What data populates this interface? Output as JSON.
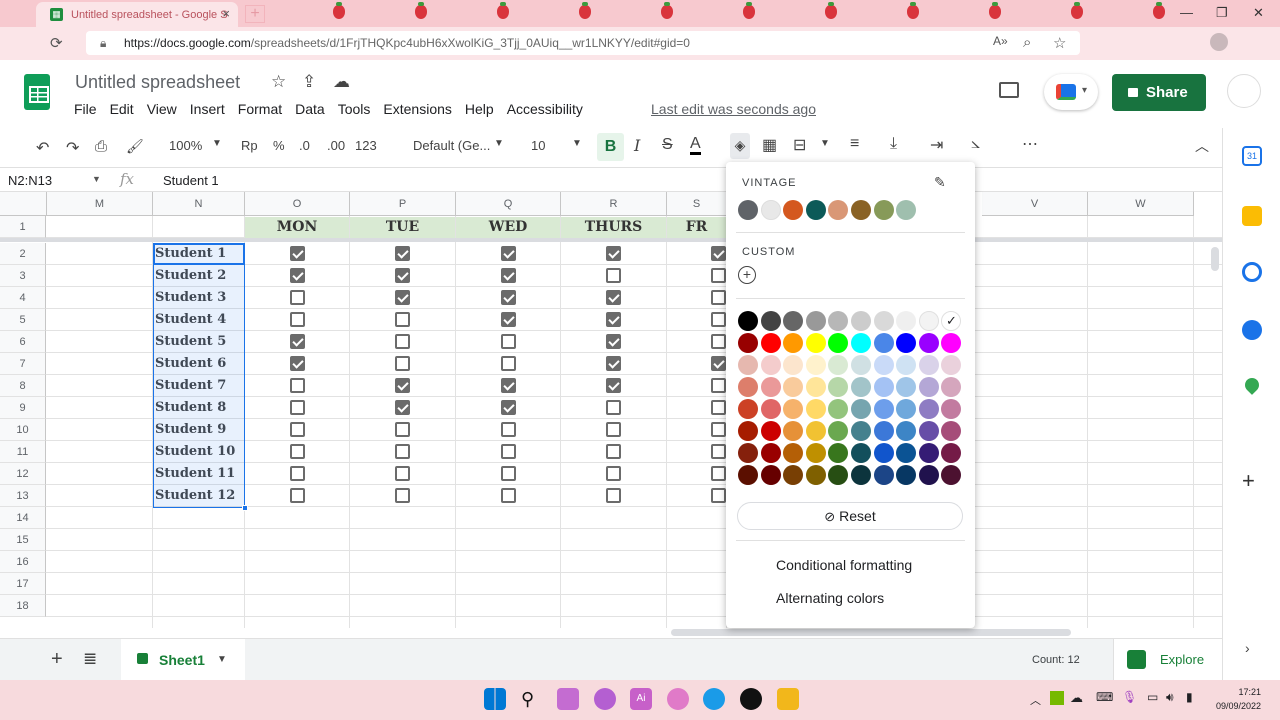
{
  "browser": {
    "tab_title": "Untitled spreadsheet - Google S",
    "url_host": "https://docs.google.com",
    "url_path": "/spreadsheets/d/1FrjTHQKpc4ubH6xXwolKiG_3Tjj_0AUiq__wr1LNKYY/edit#gid=0"
  },
  "app": {
    "doc_title": "Untitled spreadsheet",
    "menu": [
      "File",
      "Edit",
      "View",
      "Insert",
      "Format",
      "Data",
      "Tools",
      "Extensions",
      "Help",
      "Accessibility"
    ],
    "last_edit": "Last edit was seconds ago",
    "share_label": "Share"
  },
  "toolbar": {
    "zoom": "100%",
    "currency": "Rp",
    "percent": "%",
    "dec_decrease": ".0",
    "dec_increase": ".00",
    "format_more": "123",
    "font": "Default (Ge...",
    "font_size": "10",
    "bold": "B",
    "italic": "I",
    "strike": "S",
    "text_color": "A"
  },
  "formula_bar": {
    "name_box": "N2:N13",
    "fx": "fx",
    "value": "Student 1"
  },
  "grid": {
    "columns": [
      "M",
      "N",
      "O",
      "P",
      "Q",
      "R",
      "S",
      "V",
      "W"
    ],
    "rows": [
      "1",
      "2",
      "3",
      "4",
      "5",
      "6",
      "7",
      "8",
      "9",
      "10",
      "11",
      "12",
      "13",
      "14",
      "15",
      "16",
      "17",
      "18"
    ],
    "days": [
      "MON",
      "TUE",
      "WED",
      "THURS",
      "FR"
    ],
    "students": [
      "Student 1",
      "Student 2",
      "Student 3",
      "Student 4",
      "Student 5",
      "Student 6",
      "Student 7",
      "Student 8",
      "Student 9",
      "Student 10",
      "Student 11",
      "Student 12"
    ],
    "checks": [
      [
        1,
        1,
        1,
        1,
        1
      ],
      [
        1,
        1,
        1,
        0,
        0
      ],
      [
        0,
        1,
        1,
        1,
        0
      ],
      [
        0,
        0,
        1,
        1,
        0
      ],
      [
        1,
        0,
        0,
        1,
        0
      ],
      [
        1,
        0,
        0,
        1,
        1
      ],
      [
        0,
        1,
        1,
        1,
        0
      ],
      [
        0,
        1,
        1,
        0,
        0
      ],
      [
        0,
        0,
        0,
        0,
        0
      ],
      [
        0,
        0,
        0,
        0,
        0
      ],
      [
        0,
        0,
        0,
        0,
        0
      ],
      [
        0,
        0,
        0,
        0,
        0
      ]
    ]
  },
  "color_picker": {
    "vintage_label": "VINTAGE",
    "custom_label": "CUSTOM",
    "vintage": [
      "#5f6368",
      "#e8e8e8",
      "#d4581f",
      "#0c5a58",
      "#d99776",
      "#8a6224",
      "#879a59",
      "#9fbfae"
    ],
    "grays": [
      "#000000",
      "#434343",
      "#666666",
      "#999999",
      "#b7b7b7",
      "#cccccc",
      "#d9d9d9",
      "#efefef",
      "#f3f3f3",
      "#ffffff"
    ],
    "brights": [
      "#980000",
      "#ff0000",
      "#ff9900",
      "#ffff00",
      "#00ff00",
      "#00ffff",
      "#4a86e8",
      "#0000ff",
      "#9900ff",
      "#ff00ff"
    ],
    "shades": [
      [
        "#e6b8af",
        "#f4cccc",
        "#fce5cd",
        "#fff2cc",
        "#d9ead3",
        "#d0e0e3",
        "#c9daf8",
        "#cfe2f3",
        "#d9d2e9",
        "#ead1dc"
      ],
      [
        "#dd7e6b",
        "#ea9999",
        "#f9cb9c",
        "#ffe599",
        "#b6d7a8",
        "#a2c4c9",
        "#a4c2f4",
        "#9fc5e8",
        "#b4a7d6",
        "#d5a6bd"
      ],
      [
        "#cc4125",
        "#e06666",
        "#f6b26b",
        "#ffd966",
        "#93c47d",
        "#76a5af",
        "#6d9eeb",
        "#6fa8dc",
        "#8e7cc3",
        "#c27ba0"
      ],
      [
        "#a61c00",
        "#cc0000",
        "#e69138",
        "#f1c232",
        "#6aa84f",
        "#45818e",
        "#3c78d8",
        "#3d85c6",
        "#674ea7",
        "#a64d79"
      ],
      [
        "#85200c",
        "#990000",
        "#b45f06",
        "#bf9000",
        "#38761d",
        "#134f5c",
        "#1155cc",
        "#0b5394",
        "#351c75",
        "#741b47"
      ],
      [
        "#5b0f00",
        "#660000",
        "#783f04",
        "#7f6000",
        "#274e13",
        "#0c343d",
        "#1c4587",
        "#073763",
        "#20124d",
        "#4c1130"
      ]
    ],
    "reset_label": "Reset",
    "conditional_formatting": "Conditional formatting",
    "alternating_colors": "Alternating colors"
  },
  "bottom": {
    "sheet_name": "Sheet1",
    "count": "Count: 12",
    "explore": "Explore"
  },
  "taskbar": {
    "time": "17:21",
    "date": "09/09/2022"
  }
}
